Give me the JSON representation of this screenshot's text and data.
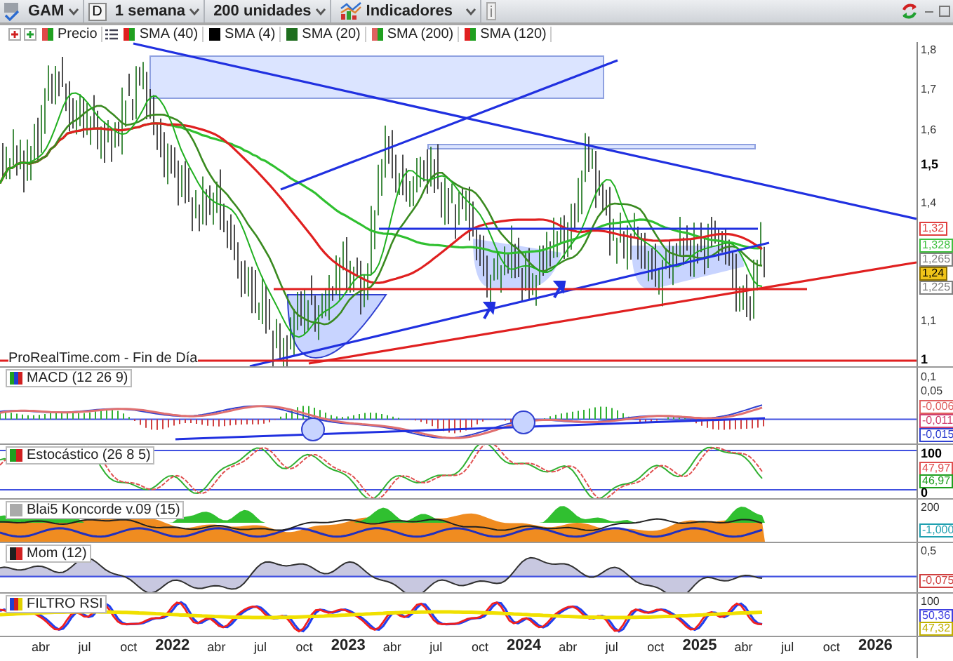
{
  "toolbar": {
    "symbol": "GAM",
    "mode": "D",
    "period": "1 semana",
    "units": "200 unidades",
    "indicators": "Indicadores"
  },
  "legend": [
    {
      "label": "Precio",
      "kind": "split",
      "color": "#e04848"
    },
    {
      "label": "SMA (40)",
      "kind": "split",
      "color": "#e02020"
    },
    {
      "label": "SMA (4)",
      "kind": "solid",
      "color": "#000000"
    },
    {
      "label": "SMA (20)",
      "kind": "solid",
      "color": "#1f6e1f"
    },
    {
      "label": "SMA (200)",
      "kind": "split",
      "color": "#e06060"
    },
    {
      "label": "SMA (120)",
      "kind": "split",
      "color": "#e02020"
    }
  ],
  "price_chart": {
    "source": "ProRealTime.com - Fin de Día",
    "axis": [
      {
        "label": "1,8",
        "kind": "tick"
      },
      {
        "label": "1,7",
        "kind": "tick"
      },
      {
        "label": "1,6",
        "kind": "tick"
      },
      {
        "label": "1,5",
        "kind": "major"
      },
      {
        "label": "1,4",
        "kind": "tick"
      },
      {
        "label": "1,32",
        "kind": "badge",
        "color": "#e04040"
      },
      {
        "label": "1,328",
        "kind": "badge",
        "color": "#40c040"
      },
      {
        "label": "1,265",
        "kind": "badge",
        "color": "#808080"
      },
      {
        "label": "1,24",
        "kind": "highlight",
        "color": "#f0c419"
      },
      {
        "label": "1,225",
        "kind": "badge",
        "color": "#808080"
      },
      {
        "label": "1,1",
        "kind": "tick"
      },
      {
        "label": "1",
        "kind": "major"
      }
    ]
  },
  "indicators": [
    {
      "kind": "macd",
      "title": "MACD (12 26 9)",
      "axis": [
        {
          "label": "0,1",
          "kind": "tick"
        },
        {
          "label": "0,05",
          "kind": "tick"
        },
        {
          "label": "-0,006",
          "kind": "badge",
          "color": "#e06060"
        },
        {
          "label": "-0,011",
          "kind": "badge",
          "color": "#d04070"
        },
        {
          "label": "-0,015",
          "kind": "badge",
          "color": "#3040d0"
        }
      ]
    },
    {
      "kind": "stochastic",
      "title": "Estocástico (26 8 5)",
      "axis": [
        {
          "label": "100",
          "kind": "major"
        },
        {
          "label": "47,97",
          "kind": "badge",
          "color": "#e05050"
        },
        {
          "label": "46,97",
          "kind": "badge",
          "color": "#20a020"
        },
        {
          "label": "0",
          "kind": "major"
        }
      ]
    },
    {
      "kind": "koncorde",
      "title": "Blai5 Koncorde v.09 (15)",
      "axis": [
        {
          "label": "200",
          "kind": "tick"
        },
        {
          "label": "-1,000",
          "kind": "badge",
          "color": "#20a0b0"
        }
      ]
    },
    {
      "kind": "momentum",
      "title": "Mom (12)",
      "axis": [
        {
          "label": "0,5",
          "kind": "tick"
        },
        {
          "label": "-0,075",
          "kind": "badge",
          "color": "#d04040"
        }
      ]
    },
    {
      "kind": "rsi",
      "title": "FILTRO RSI",
      "axis": [
        {
          "label": "100",
          "kind": "tick"
        },
        {
          "label": "50,36",
          "kind": "badge",
          "color": "#4040e0"
        },
        {
          "label": "47,32",
          "kind": "badge",
          "color": "#c0b000"
        }
      ]
    }
  ],
  "time_axis": [
    {
      "label": "abr",
      "kind": "month"
    },
    {
      "label": "jul",
      "kind": "month"
    },
    {
      "label": "oct",
      "kind": "month"
    },
    {
      "label": "2022",
      "kind": "year"
    },
    {
      "label": "abr",
      "kind": "month"
    },
    {
      "label": "jul",
      "kind": "month"
    },
    {
      "label": "oct",
      "kind": "month"
    },
    {
      "label": "2023",
      "kind": "year"
    },
    {
      "label": "abr",
      "kind": "month"
    },
    {
      "label": "jul",
      "kind": "month"
    },
    {
      "label": "oct",
      "kind": "month"
    },
    {
      "label": "2024",
      "kind": "year"
    },
    {
      "label": "abr",
      "kind": "month"
    },
    {
      "label": "jul",
      "kind": "month"
    },
    {
      "label": "oct",
      "kind": "month"
    },
    {
      "label": "2025",
      "kind": "year"
    },
    {
      "label": "abr",
      "kind": "month"
    },
    {
      "label": "jul",
      "kind": "month"
    },
    {
      "label": "oct",
      "kind": "month"
    },
    {
      "label": "2026",
      "kind": "year"
    }
  ]
}
